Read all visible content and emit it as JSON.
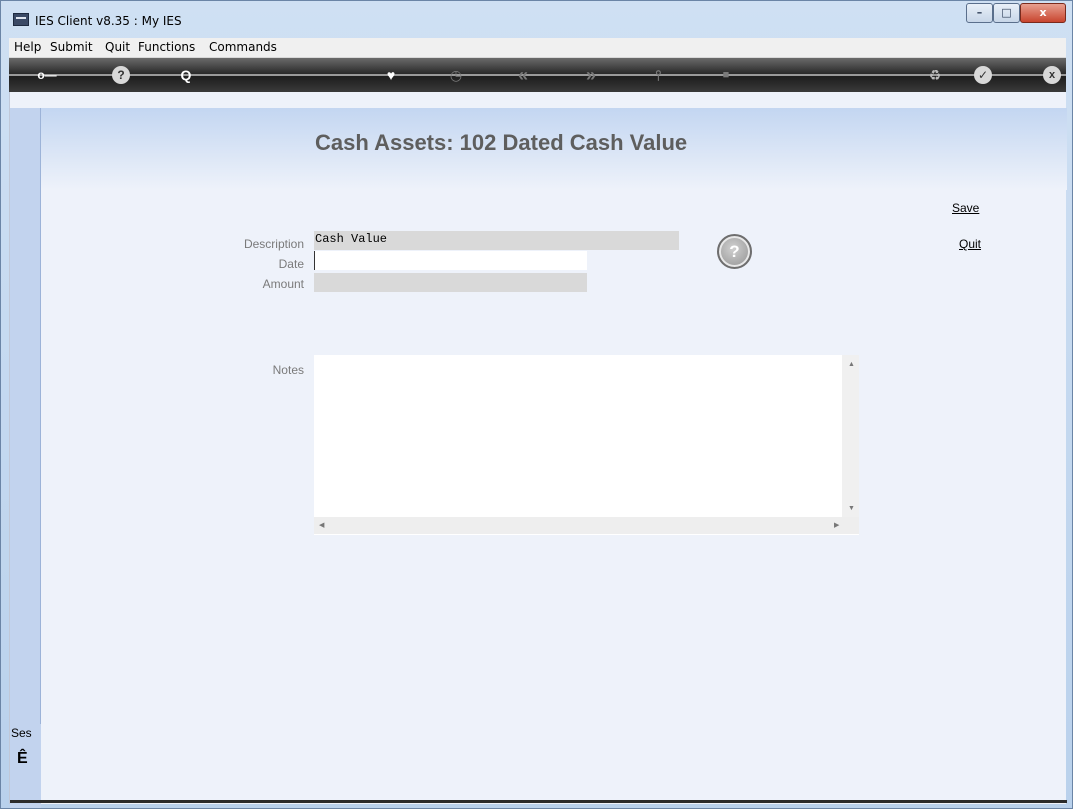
{
  "window": {
    "title": "IES Client v8.35 : My IES",
    "controls": {
      "minimize": "–",
      "maximize": "□",
      "close": "x"
    }
  },
  "menubar": {
    "items": [
      "Help",
      "Submit",
      "Quit",
      "Functions",
      "Commands"
    ]
  },
  "toolbar": {
    "icons": [
      "key-icon",
      "help-icon",
      "search-icon",
      "heart-icon",
      "clock-icon",
      "rewind-icon",
      "fast-forward-icon",
      "tools-icon",
      "stop-icon",
      "recycle-icon",
      "check-icon",
      "close-icon"
    ],
    "glyphs": {
      "key": "o—",
      "help": "?",
      "search": "Q",
      "heart": "♥",
      "clock": "◷",
      "rewind": "«",
      "forward": "»",
      "tools": "⫯",
      "stop": "■",
      "recycle": "♻",
      "check": "✓",
      "close": "x"
    }
  },
  "page": {
    "title": "Cash Assets: 102 Dated Cash Value"
  },
  "form": {
    "description": {
      "label": "Description",
      "value": "Cash Value"
    },
    "date": {
      "label": "Date",
      "value": ""
    },
    "amount": {
      "label": "Amount",
      "value": ""
    },
    "notes": {
      "label": "Notes",
      "value": ""
    },
    "help_glyph": "?"
  },
  "actions": {
    "save": "Save",
    "quit": "Quit"
  },
  "session": {
    "label": "Ses",
    "glyph": "Ê"
  },
  "colors": {
    "toolbar": "#1e1e1e",
    "content_bg": "#eef2fa",
    "title_text": "#5e5e5e",
    "field_bg": "#d9d9d9"
  }
}
